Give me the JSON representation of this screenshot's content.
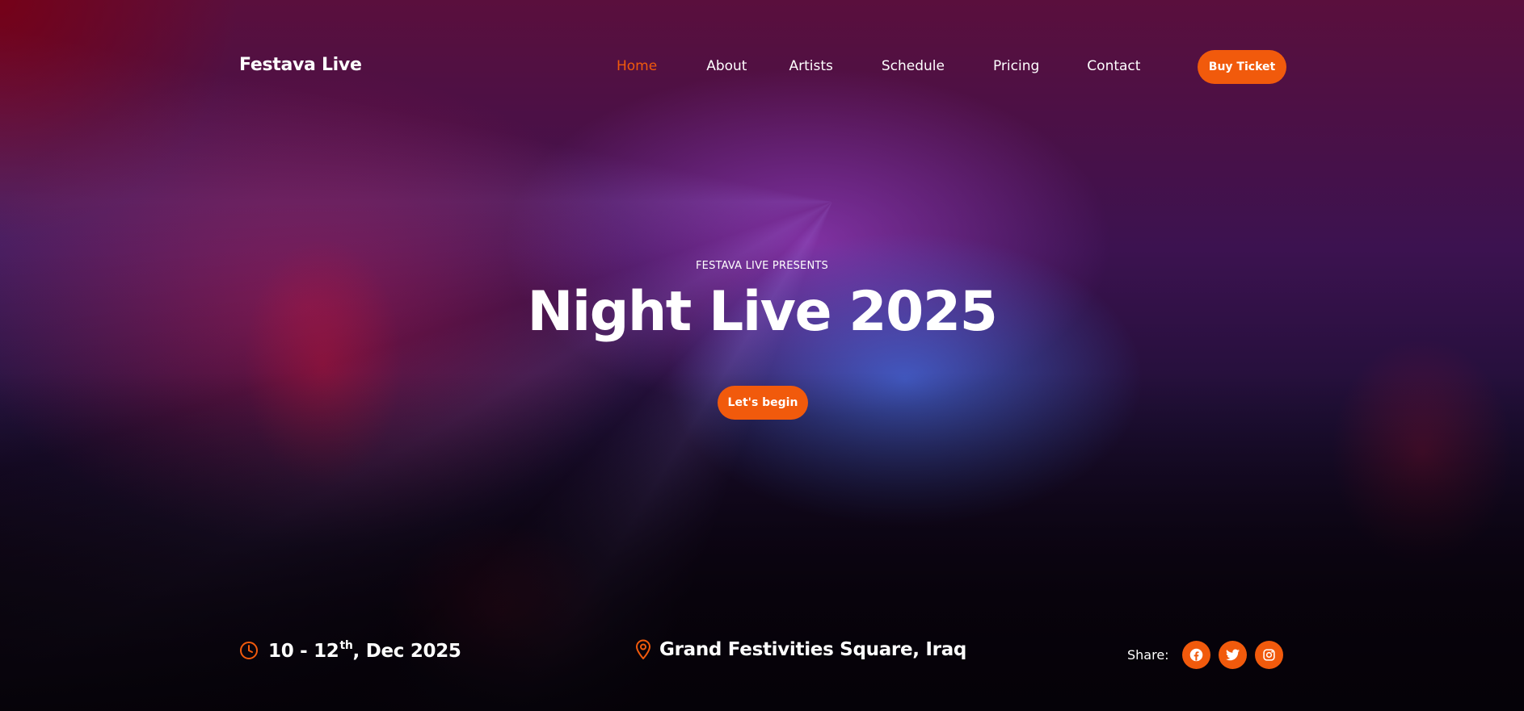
{
  "header": {
    "brand": "Festava Live",
    "nav": [
      {
        "label": "Home",
        "active": true
      },
      {
        "label": "About",
        "active": false
      },
      {
        "label": "Artists",
        "active": false
      },
      {
        "label": "Schedule",
        "active": false
      },
      {
        "label": "Pricing",
        "active": false
      },
      {
        "label": "Contact",
        "active": false
      }
    ],
    "ticket_button": "Buy Ticket"
  },
  "hero": {
    "presents": "FESTAVA LIVE PRESENTS",
    "title": "Night Live 2025",
    "cta": "Let's begin"
  },
  "event": {
    "date_prefix": "10 - 12",
    "date_sup": "th",
    "date_suffix": ", Dec 2025",
    "location": "Grand Festivities Square, Iraq"
  },
  "share": {
    "label": "Share:",
    "icons": [
      "facebook-icon",
      "twitter-icon",
      "instagram-icon"
    ]
  },
  "colors": {
    "accent": "#f15a0c",
    "text": "#ffffff"
  }
}
